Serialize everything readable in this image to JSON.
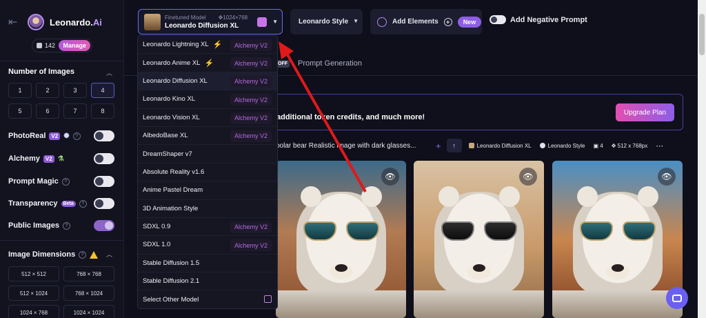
{
  "brand": {
    "name": "Leonardo.",
    "ai": "Ai"
  },
  "tokens": {
    "count": "142",
    "manage": "Manage"
  },
  "sidebar": {
    "num_images_title": "Number of Images",
    "num_images": [
      "1",
      "2",
      "3",
      "4",
      "5",
      "6",
      "7",
      "8"
    ],
    "selected_num": "4",
    "options": [
      {
        "label": "PhotoReal",
        "badge": "V2",
        "on": false
      },
      {
        "label": "Alchemy",
        "badge": "V2",
        "on": false
      },
      {
        "label": "Prompt Magic",
        "badge": "",
        "on": false
      },
      {
        "label": "Transparency",
        "badge": "Beta",
        "on": false
      },
      {
        "label": "Public Images",
        "badge": "",
        "on": true
      }
    ],
    "dimensions_title": "Image Dimensions",
    "dimensions": [
      "512 × 512",
      "768 × 768",
      "512 × 1024",
      "768 × 1024",
      "1024 × 768",
      "1024 × 1024"
    ]
  },
  "model_selector": {
    "subtitle": "Finetuned Model",
    "size": "1024×768",
    "name": "Leonardo Diffusion XL"
  },
  "style_selector": {
    "label": "Leonardo Style"
  },
  "add_elements": {
    "label": "Add Elements",
    "badge": "New"
  },
  "negative_prompt": {
    "label": "Add Negative Prompt"
  },
  "tabs": {
    "off_badge": "OFF",
    "prompt_generation": "Prompt Generation"
  },
  "banner": {
    "text": "additional token credits, and much more!",
    "button": "Upgrade Plan"
  },
  "prompt": {
    "text": "polar bear Realistic image with dark glasses...",
    "model": "Leonardo Diffusion XL",
    "style": "Leonardo Style",
    "count": "4",
    "size": "512 x 768px"
  },
  "dropdown": {
    "items": [
      {
        "label": "Leonardo Lightning XL",
        "tag": "Alchemy V2",
        "bolt": true
      },
      {
        "label": "Leonardo Anime XL",
        "tag": "Alchemy V2",
        "bolt": true
      },
      {
        "label": "Leonardo Diffusion XL",
        "tag": "Alchemy V2",
        "bolt": false
      },
      {
        "label": "Leonardo Kino XL",
        "tag": "Alchemy V2",
        "bolt": false
      },
      {
        "label": "Leonardo Vision XL",
        "tag": "Alchemy V2",
        "bolt": false
      },
      {
        "label": "AlbedoBase XL",
        "tag": "Alchemy V2",
        "bolt": false
      },
      {
        "label": "DreamShaper v7",
        "tag": "",
        "bolt": false
      },
      {
        "label": "Absolute Reality v1.6",
        "tag": "",
        "bolt": false
      },
      {
        "label": "Anime Pastel Dream",
        "tag": "",
        "bolt": false
      },
      {
        "label": "3D Animation Style",
        "tag": "",
        "bolt": false
      },
      {
        "label": "SDXL 0.9",
        "tag": "Alchemy V2",
        "bolt": false
      },
      {
        "label": "SDXL 1.0",
        "tag": "Alchemy V2",
        "bolt": false
      },
      {
        "label": "Stable Diffusion 1.5",
        "tag": "",
        "bolt": false
      },
      {
        "label": "Stable Diffusion 2.1",
        "tag": "",
        "bolt": false
      },
      {
        "label": "Select Other Model",
        "tag": "",
        "bolt": false
      }
    ]
  },
  "colors": {
    "accent": "#8e5ee6",
    "annotation_arrow": "#e0191a",
    "alchemy_text": "#b36be0"
  }
}
